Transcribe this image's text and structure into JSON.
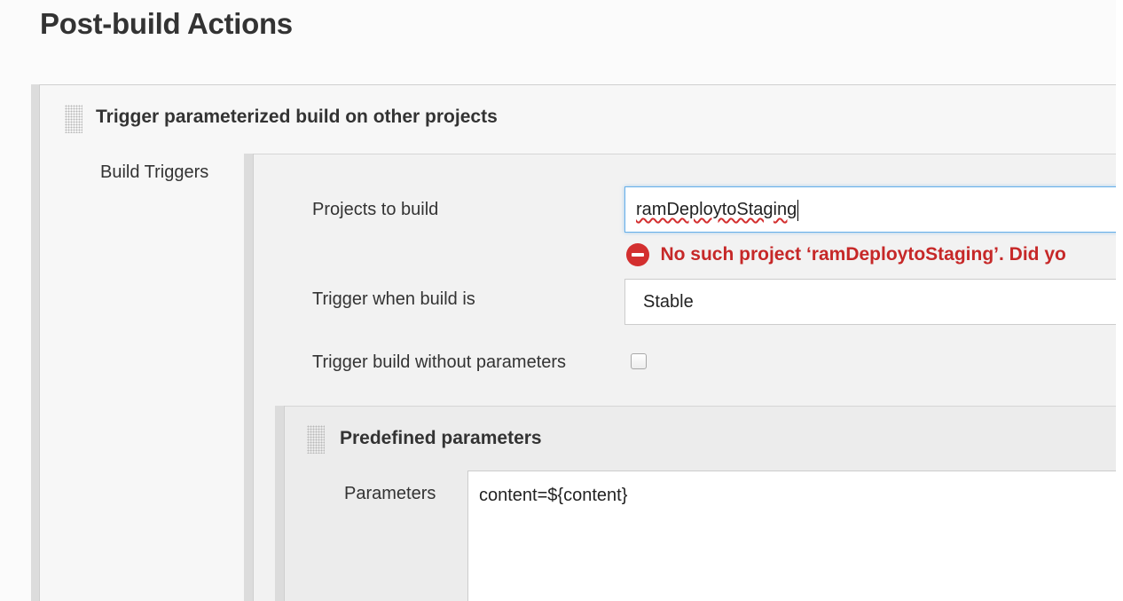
{
  "page": {
    "section_title": "Post-build Actions"
  },
  "trigger_block": {
    "title": "Trigger parameterized build on other projects",
    "build_triggers_label": "Build Triggers",
    "projects_label": "Projects to build",
    "projects_value": "ramDeploytoStaging",
    "error_message": "No such project ‘ramDeploytoStaging’. Did yo",
    "trigger_when_label": "Trigger when build is",
    "trigger_when_value": "Stable",
    "no_params_label": "Trigger build without parameters",
    "no_params_checked": false
  },
  "predefined": {
    "title": "Predefined parameters",
    "params_label": "Parameters",
    "params_value": "content=${content}"
  },
  "colors": {
    "error": "#c62828",
    "focus_border": "#66afe9"
  },
  "icons": {
    "error": "error-circle-icon",
    "drag": "drag-handle-icon"
  }
}
